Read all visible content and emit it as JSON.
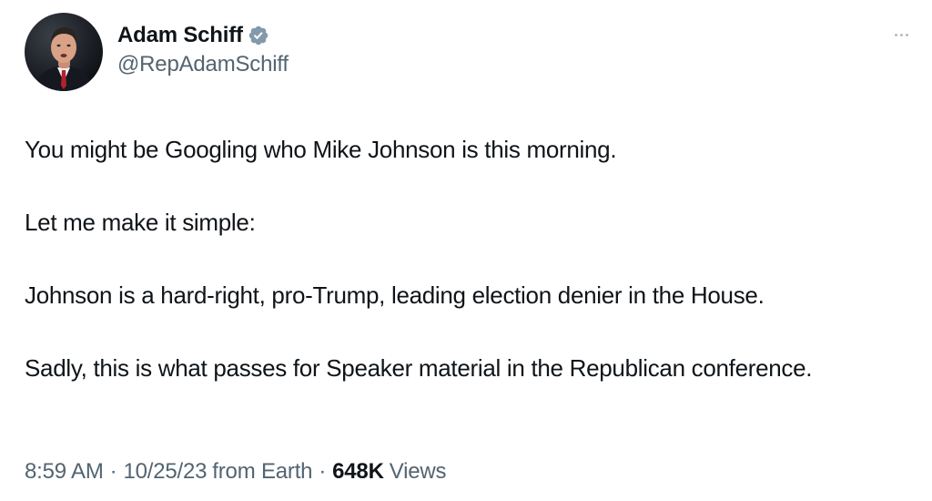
{
  "author": {
    "display_name": "Adam Schiff",
    "handle": "@RepAdamSchiff",
    "verified_icon": "verified-badge-icon",
    "verified_color": "#829aab"
  },
  "more_menu": {
    "icon": "more-horizontal-icon"
  },
  "tweet": {
    "paragraphs": [
      "You might be Googling who Mike Johnson is this morning.",
      "Let me make it simple:",
      "Johnson is a hard-right, pro-Trump, leading election denier in the House.",
      "Sadly, this is what passes for Speaker material in the Republican conference."
    ]
  },
  "meta": {
    "time": "8:59 AM",
    "separator": "·",
    "date": "10/25/23",
    "source": "from Earth",
    "views_count": "648K",
    "views_label": "Views"
  },
  "colors": {
    "text_primary": "#0f1419",
    "text_secondary": "#536471",
    "background": "#ffffff"
  }
}
